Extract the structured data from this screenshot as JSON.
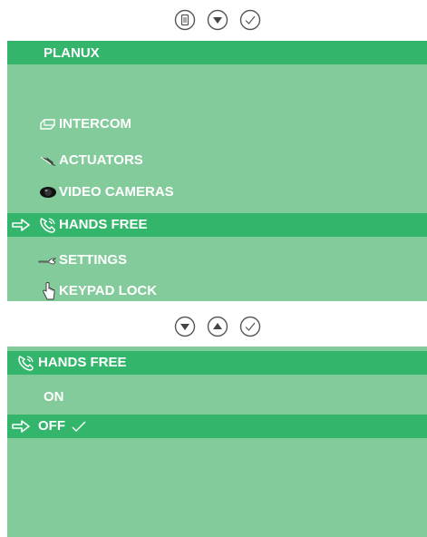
{
  "top_buttons": [
    {
      "icon": "menu-icon"
    },
    {
      "icon": "down-arrow-icon"
    },
    {
      "icon": "check-icon"
    }
  ],
  "menu": {
    "title": "PLANUX",
    "items": [
      {
        "label": "INTERCOM",
        "icon": "intercom-icon",
        "selected": false
      },
      {
        "label": "ACTUATORS",
        "icon": "actuator-icon",
        "selected": false
      },
      {
        "label": "VIDEO CAMERAS",
        "icon": "camera-icon",
        "selected": false
      },
      {
        "label": "HANDS FREE",
        "icon": "phone-icon",
        "selected": true
      },
      {
        "label": "SETTINGS",
        "icon": "wrench-icon",
        "selected": false
      },
      {
        "label": "KEYPAD LOCK",
        "icon": "hand-pointer-icon",
        "selected": false
      }
    ]
  },
  "middle_buttons": [
    {
      "icon": "down-arrow-icon"
    },
    {
      "icon": "up-arrow-icon"
    },
    {
      "icon": "check-icon"
    }
  ],
  "submenu": {
    "title": "HANDS FREE",
    "icon": "phone-icon",
    "options": [
      {
        "label": "ON",
        "selected": false
      },
      {
        "label": "OFF",
        "selected": true,
        "checked": true
      }
    ]
  },
  "colors": {
    "panel": "#83cb9b",
    "highlight": "#33b56b",
    "text": "#ffffff",
    "button_stroke": "#555555"
  }
}
